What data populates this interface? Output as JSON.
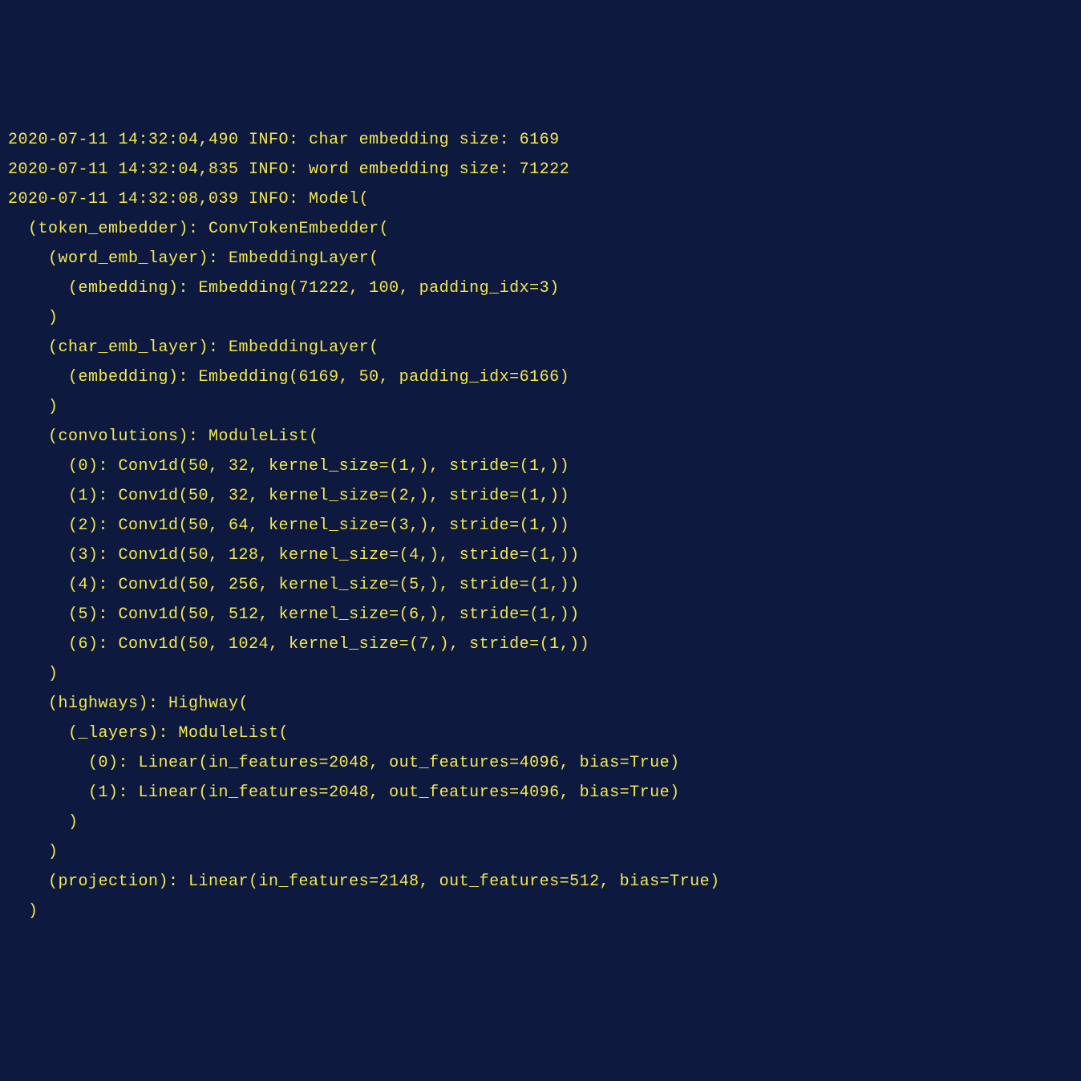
{
  "lines": [
    "2020-07-11 14:32:04,490 INFO: char embedding size: 6169",
    "2020-07-11 14:32:04,835 INFO: word embedding size: 71222",
    "2020-07-11 14:32:08,039 INFO: Model(",
    "  (token_embedder): ConvTokenEmbedder(",
    "    (word_emb_layer): EmbeddingLayer(",
    "      (embedding): Embedding(71222, 100, padding_idx=3)",
    "    )",
    "    (char_emb_layer): EmbeddingLayer(",
    "      (embedding): Embedding(6169, 50, padding_idx=6166)",
    "    )",
    "    (convolutions): ModuleList(",
    "      (0): Conv1d(50, 32, kernel_size=(1,), stride=(1,))",
    "      (1): Conv1d(50, 32, kernel_size=(2,), stride=(1,))",
    "      (2): Conv1d(50, 64, kernel_size=(3,), stride=(1,))",
    "      (3): Conv1d(50, 128, kernel_size=(4,), stride=(1,))",
    "      (4): Conv1d(50, 256, kernel_size=(5,), stride=(1,))",
    "      (5): Conv1d(50, 512, kernel_size=(6,), stride=(1,))",
    "      (6): Conv1d(50, 1024, kernel_size=(7,), stride=(1,))",
    "    )",
    "    (highways): Highway(",
    "      (_layers): ModuleList(",
    "        (0): Linear(in_features=2048, out_features=4096, bias=True)",
    "        (1): Linear(in_features=2048, out_features=4096, bias=True)",
    "      )",
    "    )",
    "    (projection): Linear(in_features=2148, out_features=512, bias=True)",
    "  )"
  ]
}
